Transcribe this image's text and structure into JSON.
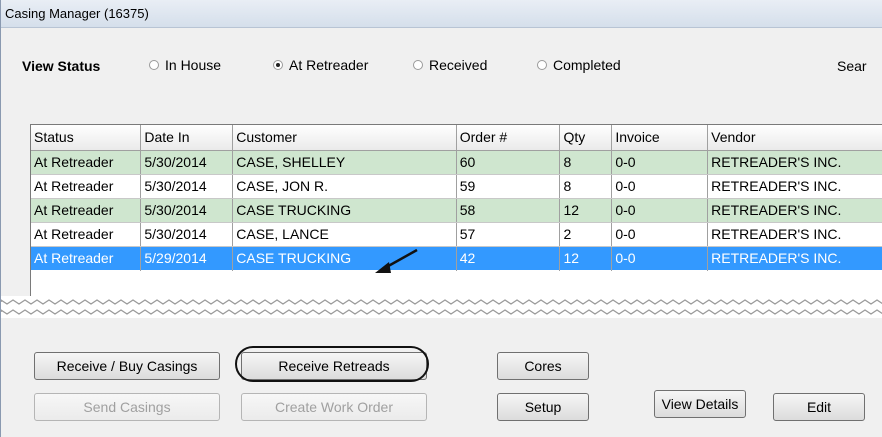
{
  "window": {
    "title": "Casing Manager (16375)"
  },
  "view_status": {
    "label": "View Status",
    "options": [
      {
        "label": "In House",
        "selected": false
      },
      {
        "label": "At Retreader",
        "selected": true
      },
      {
        "label": "Received",
        "selected": false
      },
      {
        "label": "Completed",
        "selected": false
      }
    ]
  },
  "search_label": "Sear",
  "table": {
    "columns": [
      "Status",
      "Date In",
      "Customer",
      "Order #",
      "Qty",
      "Invoice",
      "Vendor"
    ],
    "rows": [
      [
        "At Retreader",
        "5/30/2014",
        "CASE, SHELLEY",
        "60",
        "8",
        "0-0",
        "RETREADER'S INC."
      ],
      [
        "At Retreader",
        "5/30/2014",
        "CASE, JON R.",
        "59",
        "8",
        "0-0",
        "RETREADER'S INC."
      ],
      [
        "At Retreader",
        "5/30/2014",
        "CASE TRUCKING",
        "58",
        "12",
        "0-0",
        "RETREADER'S INC."
      ],
      [
        "At Retreader",
        "5/30/2014",
        "CASE, LANCE",
        "57",
        "2",
        "0-0",
        "RETREADER'S INC."
      ],
      [
        "At Retreader",
        "5/29/2014",
        "CASE TRUCKING",
        "42",
        "12",
        "0-0",
        "RETREADER'S INC."
      ]
    ],
    "selected_row": 4
  },
  "buttons": {
    "receive_buy_casings": "Receive / Buy Casings",
    "receive_retreads": "Receive Retreads",
    "cores": "Cores",
    "send_casings": "Send Casings",
    "create_work_order": "Create Work Order",
    "setup": "Setup",
    "view_details": "View Details",
    "edit": "Edit"
  },
  "colors": {
    "alt_row": "#cfe6cf",
    "selection": "#3399ff"
  },
  "icons": [
    "annotation-arrow-icon"
  ]
}
